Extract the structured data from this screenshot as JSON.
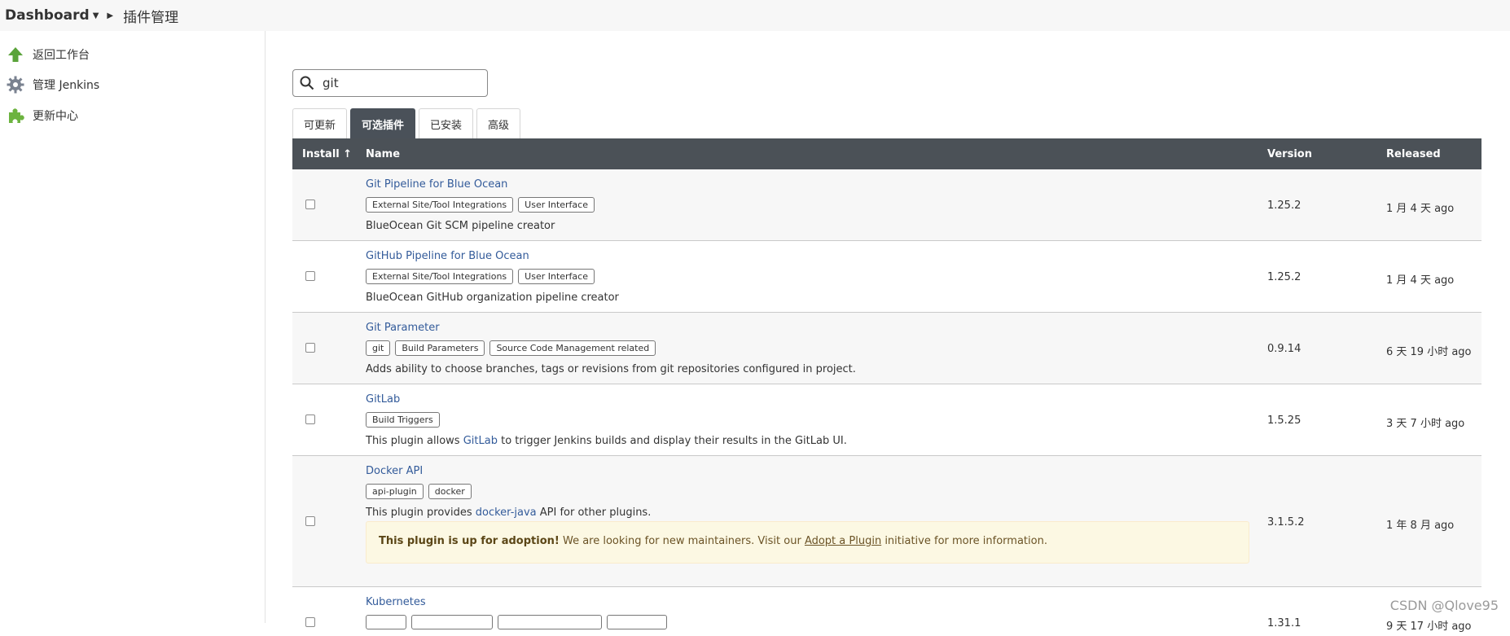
{
  "breadcrumb": {
    "root": "Dashboard",
    "page": "插件管理"
  },
  "sidebar": {
    "items": [
      {
        "label": "返回工作台",
        "icon": "up-arrow-icon"
      },
      {
        "label": "管理 Jenkins",
        "icon": "gear-icon"
      },
      {
        "label": "更新中心",
        "icon": "puzzle-icon"
      }
    ]
  },
  "search": {
    "value": "git",
    "icon": "search-icon"
  },
  "tabs": [
    "可更新",
    "可选插件",
    "已安装",
    "高级"
  ],
  "active_tab": "可选插件",
  "table": {
    "headers": {
      "install": "Install ↑",
      "name": "Name",
      "version": "Version",
      "released": "Released"
    },
    "rows": [
      {
        "name": "Git Pipeline for Blue Ocean",
        "labels": [
          "External Site/Tool Integrations",
          "User Interface"
        ],
        "desc": "BlueOcean Git SCM pipeline creator",
        "version": "1.25.2",
        "released": "1 月 4 天 ago"
      },
      {
        "name": "GitHub Pipeline for Blue Ocean",
        "labels": [
          "External Site/Tool Integrations",
          "User Interface"
        ],
        "desc": "BlueOcean GitHub organization pipeline creator",
        "version": "1.25.2",
        "released": "1 月 4 天 ago"
      },
      {
        "name": "Git Parameter",
        "labels": [
          "git",
          "Build Parameters",
          "Source Code Management related"
        ],
        "desc": "Adds ability to choose branches, tags or revisions from git repositories configured in project.",
        "version": "0.9.14",
        "released": "6 天 19 小时 ago"
      },
      {
        "name": "GitLab",
        "labels": [
          "Build Triggers"
        ],
        "desc_pre": "This plugin allows ",
        "desc_link": "GitLab",
        "desc_post": " to trigger Jenkins builds and display their results in the GitLab UI.",
        "version": "1.5.25",
        "released": "3 天 7 小时 ago"
      },
      {
        "name": "Docker API",
        "labels": [
          "api-plugin",
          "docker"
        ],
        "desc_pre": "This plugin provides ",
        "desc_link": "docker-java",
        "desc_post": " API for other plugins.",
        "adopt_bold": "This plugin is up for adoption!",
        "adopt_text": " We are looking for new maintainers. Visit our ",
        "adopt_link": "Adopt a Plugin",
        "adopt_tail": " initiative for more information.",
        "version": "3.1.5.2",
        "released": "1 年 8 月 ago"
      },
      {
        "name": "Kubernetes",
        "version": "1.31.1",
        "released": "9 天 17 小时 ago"
      }
    ]
  },
  "watermark": "CSDN @Qlove95",
  "colors": {
    "header_bg": "#4b5157",
    "link": "#335b9a",
    "adopt_bg": "#fcf8e3",
    "row_shade": "#f7f7f7"
  }
}
